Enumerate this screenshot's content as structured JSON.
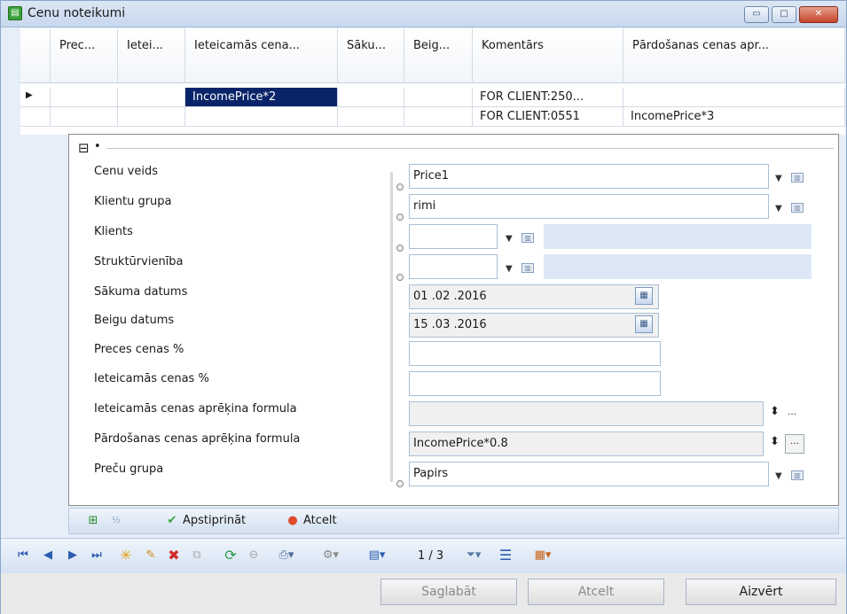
{
  "window": {
    "title": "Cenu noteikumi",
    "controls": {
      "minimize": "▭",
      "maximize": "□",
      "close": "✕"
    }
  },
  "grid": {
    "columns": [
      "Prec...",
      "Ietei...",
      "Ieteicamās cena...",
      "Sāku...",
      "Beig...",
      "Komentārs",
      "Pārdošanas cenas apr..."
    ],
    "rows": [
      {
        "indicator": "▶",
        "cells": [
          "",
          "",
          "IncomePrice*2",
          "",
          "",
          "FOR CLIENT:250...",
          ""
        ]
      },
      {
        "indicator": "",
        "cells": [
          "",
          "",
          "",
          "",
          "",
          "FOR CLIENT:0551",
          "IncomePrice*3"
        ]
      }
    ]
  },
  "detail": {
    "collapse_icon": "⊟",
    "bullet": "•",
    "fields": {
      "price_type": {
        "label": "Cenu veids",
        "value": "Price1"
      },
      "client_group": {
        "label": "Klientu grupa",
        "value": "rimi"
      },
      "client": {
        "label": "Klients",
        "value": ""
      },
      "unit": {
        "label": "Struktūrvienība",
        "value": ""
      },
      "start_date": {
        "label": "Sākuma datums",
        "value": "01 .02 .2016"
      },
      "end_date": {
        "label": "Beigu datums",
        "value": "15 .03 .2016"
      },
      "item_price_pct": {
        "label": "Preces cenas %",
        "value": ""
      },
      "recommended_price_pct": {
        "label": "Ieteicamās cenas %",
        "value": ""
      },
      "recommended_formula": {
        "label": "Ieteicamās cenas aprēķina formula",
        "value": ""
      },
      "sales_formula": {
        "label": "Pārdošanas cenas aprēķina formula",
        "value": "IncomePrice*0.8"
      },
      "item_group": {
        "label": "Preču grupa",
        "value": "Papirs"
      }
    }
  },
  "actionbar": {
    "confirm_label": "Apstiprināt",
    "cancel_label": "Atcelt"
  },
  "navbar": {
    "page_indicator": "1 / 3"
  },
  "footer": {
    "save_label": "Saglabāt",
    "cancel_label": "Atcelt",
    "close_label": "Aizvērt"
  },
  "colors": {
    "selection": "#0a246a",
    "window_bg": "#e6eef8",
    "accent_green": "#3aa33a",
    "accent_red": "#e04a2a"
  }
}
